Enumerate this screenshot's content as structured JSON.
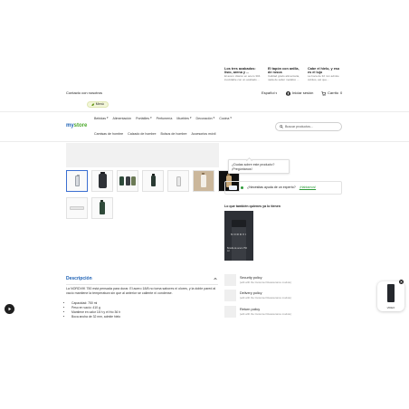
{
  "top_cards": [
    {
      "title": "Los tres acabados: lisío, arena y ...",
      "desc": "El acero clásico en acero 304 inoxidable con un acabado ..."
    },
    {
      "title": "El tapón con anilla, de rosca",
      "desc": "Calidad grado alimentaria, nada de sabor metálico ..."
    },
    {
      "title": "Cabe el hielo, y eso es el lujo",
      "desc": "La boca de 32 mm admite cubitos, así que..."
    }
  ],
  "header": {
    "contact_label": "Contacto con nosotros",
    "language_label": "Español",
    "login_label": "Iniciar sesión",
    "cart_label": "Carrito",
    "cart_count": "0",
    "pill_label": "Menú"
  },
  "nav": {
    "logo_main": "my",
    "logo_accent": "store",
    "row1": [
      "Bebidas",
      "Alimentación",
      "Portátiles",
      "Perfumería",
      "Muebles",
      "Decoración",
      "Cocina"
    ],
    "row2": [
      "Camisas de hombre",
      "Calzado de hombre",
      "Bolsos de hombre",
      "Accesorios móvil"
    ],
    "search_placeholder": "Buscar productos..."
  },
  "tooltip": {
    "line1": "¿Dudas sobre este producto?",
    "line2": "¡Pregúntanos!"
  },
  "expert": {
    "text": "¿Necesitas ayuda de un experto?",
    "link": "¡Hablamos!"
  },
  "bought_title": "Lo que también quienes ya lo tienen",
  "promo": {
    "brand": "NORDVI",
    "text": "Botella de acero 750 ml"
  },
  "description": {
    "title": "Descripción",
    "body": "La NORDVIK 750 está pensada para durar. El acero 18/8 no toma sabores ni olores, y la doble pared al vacío mantiene la temperatura sin que al anterior se caliente ni condense.",
    "specs": [
      "Capacidad: 750 ml",
      "Peso en vacío: 410 g",
      "Mantiene en calor 18 h y el frío 36 h",
      "Boca ancha de 32 mm, admite hielo"
    ]
  },
  "policies": [
    {
      "title": "Security policy",
      "desc": "(edit with the Customer Reassurance module)"
    },
    {
      "title": "Delivery policy",
      "desc": "(edit with the Customer Reassurance module)"
    },
    {
      "title": "Return policy",
      "desc": "(edit with the Customer Reassurance module)"
    }
  ],
  "floating": {
    "label": "VIDEO"
  },
  "colors": {
    "accent": "#1a5fb4",
    "logo_green": "#4aa82a",
    "expert_green": "#2e9b3a"
  }
}
